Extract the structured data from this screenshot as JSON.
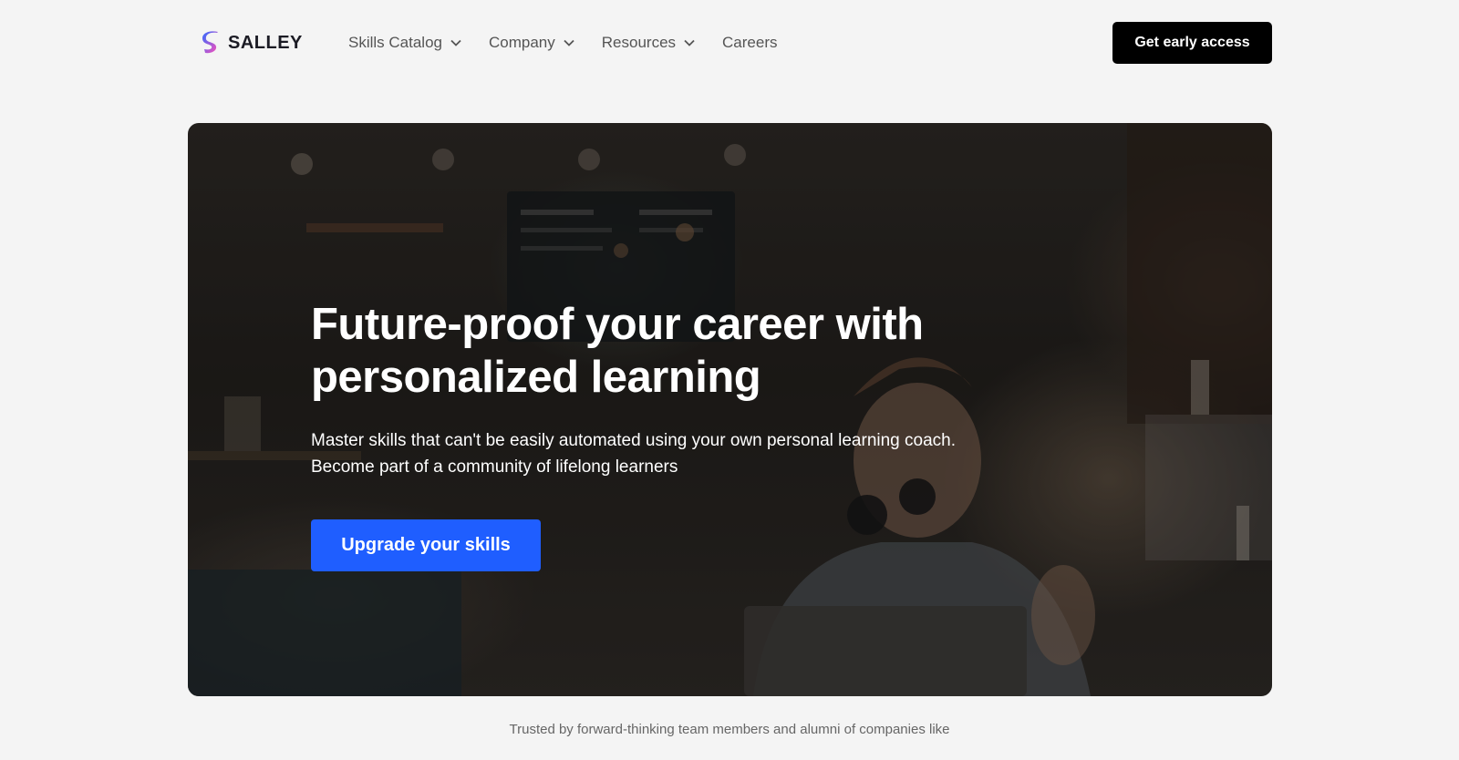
{
  "brand": {
    "name": "SALLEY",
    "logo_icon": "salley-logo-icon",
    "gradient": [
      "#2f6bff",
      "#ff4fb8"
    ]
  },
  "nav": {
    "items": [
      {
        "label": "Skills Catalog",
        "dropdown": true
      },
      {
        "label": "Company",
        "dropdown": true
      },
      {
        "label": "Resources",
        "dropdown": true
      },
      {
        "label": "Careers",
        "dropdown": false
      }
    ],
    "cta_label": "Get early access"
  },
  "hero": {
    "title": "Future-proof your career with personalized learning",
    "subtitle_lines": [
      "Master skills that can't be easily automated using your own personal learning coach.",
      "Become part of a community of lifelong learners"
    ],
    "cta_label": "Upgrade your skills",
    "background_image": "cafe-person-with-headphones-photo"
  },
  "trusted_text": "Trusted by forward-thinking team members and alumni of companies like",
  "colors": {
    "primary": "#1f5eff",
    "dark_button": "#000000",
    "page_bg": "#f4f4f4"
  }
}
